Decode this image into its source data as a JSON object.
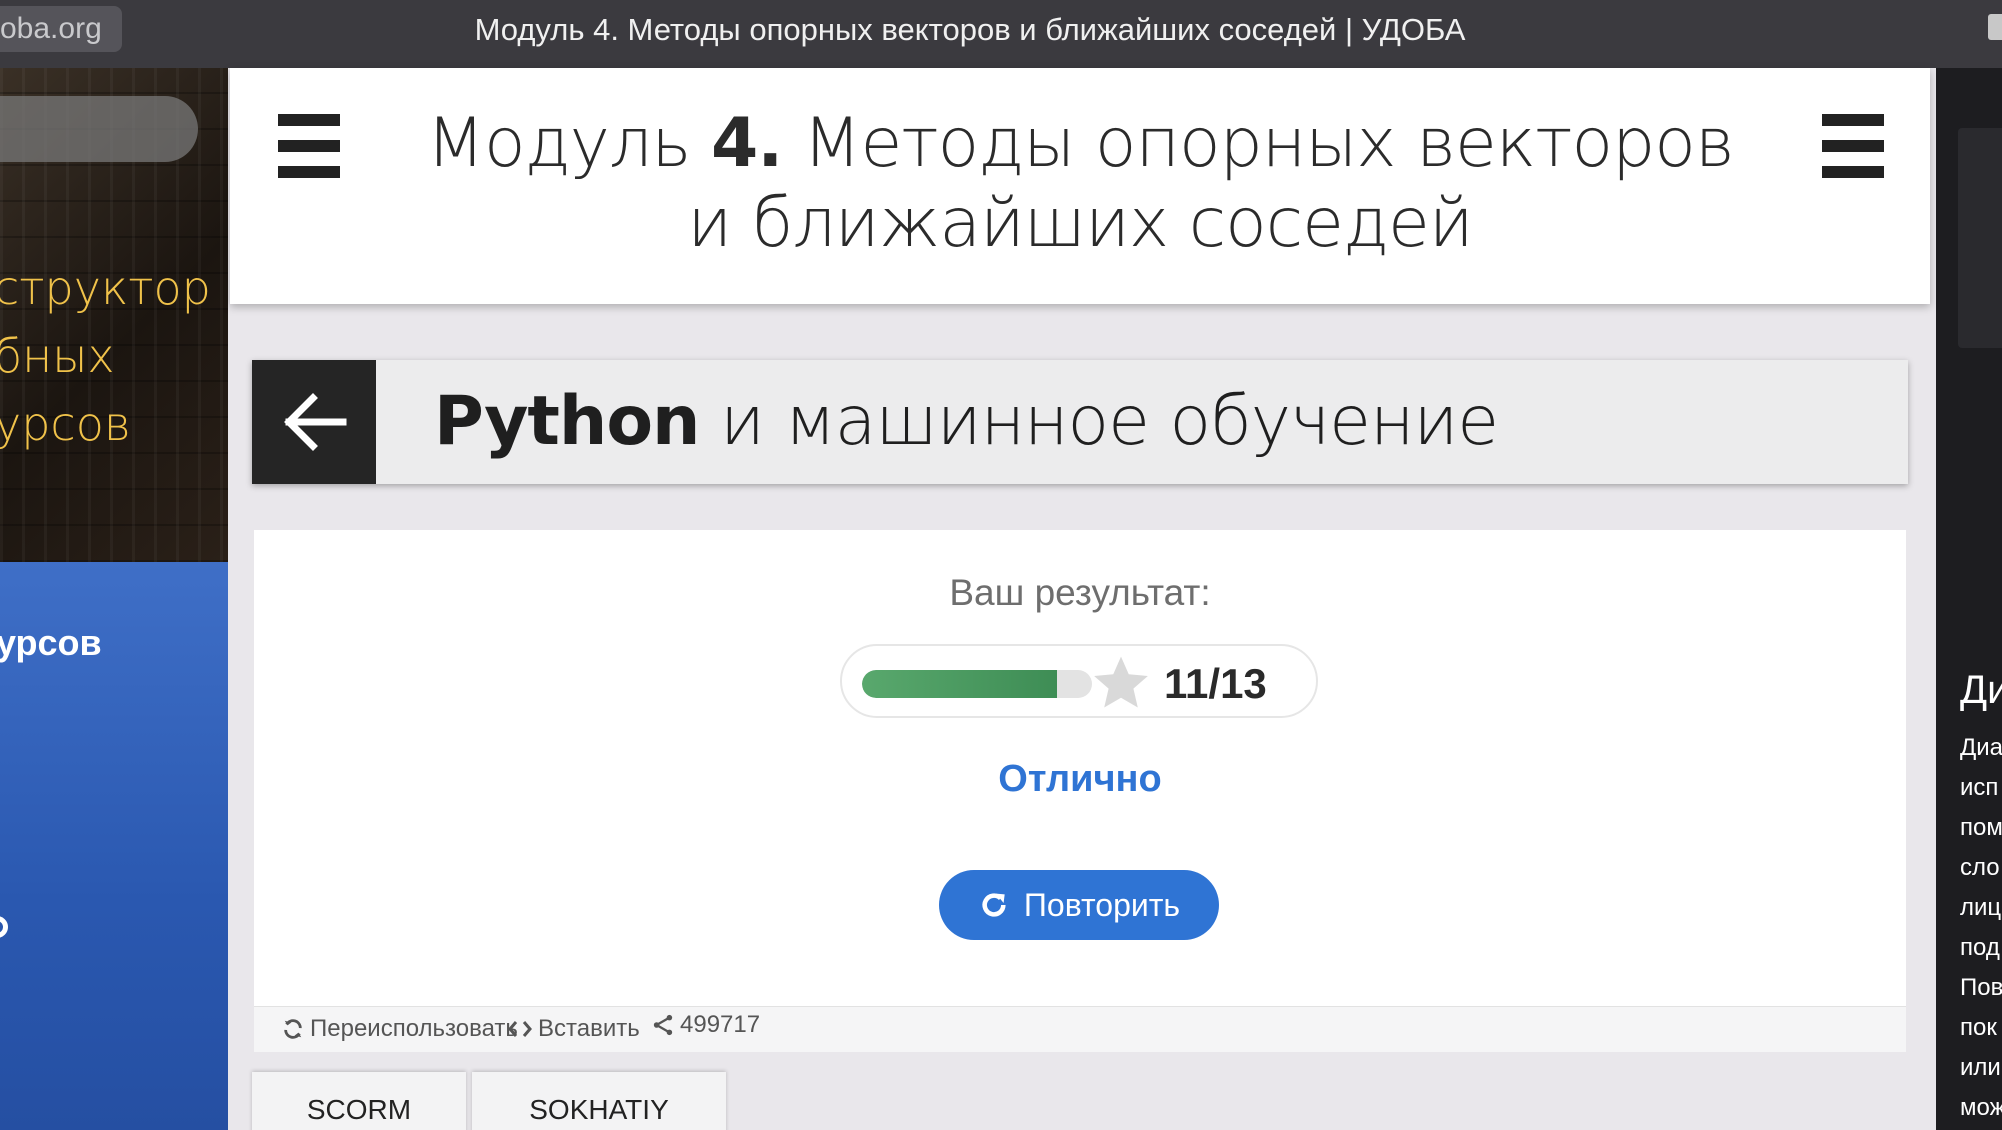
{
  "browser": {
    "url_fragment": "oba.org",
    "window_title": "Модуль 4. Методы опорных векторов и ближайших соседей | УДОБА"
  },
  "sidebar": {
    "brand_lines": "структор\nбных\nурсов",
    "menu_item": "урсов"
  },
  "header": {
    "title_prefix": "Модуль ",
    "title_number": "4.",
    "title_rest": " Методы опорных векторов и ближайших соседей"
  },
  "course": {
    "title_strong": "Python",
    "title_rest": " и машинное обучение"
  },
  "result": {
    "label": "Ваш результат:",
    "score": "11/13",
    "score_fraction": 0.846,
    "grade": "Отлично",
    "retry_label": "Повторить"
  },
  "actions": {
    "reuse": "Переиспользовать",
    "embed": "Вставить",
    "share_count": "499717"
  },
  "tabs": [
    "SCORM",
    "SOKHATIY"
  ],
  "right_panel": {
    "heading": "Ди",
    "lines": [
      "Диа",
      "исп",
      "пом",
      "сло",
      "лиц",
      "под",
      "Пов",
      "пок",
      "или",
      "мож"
    ]
  },
  "colors": {
    "accent_blue": "#2f74d4",
    "progress_green": "#3e8d55",
    "brand_gold": "#f0c24a"
  }
}
